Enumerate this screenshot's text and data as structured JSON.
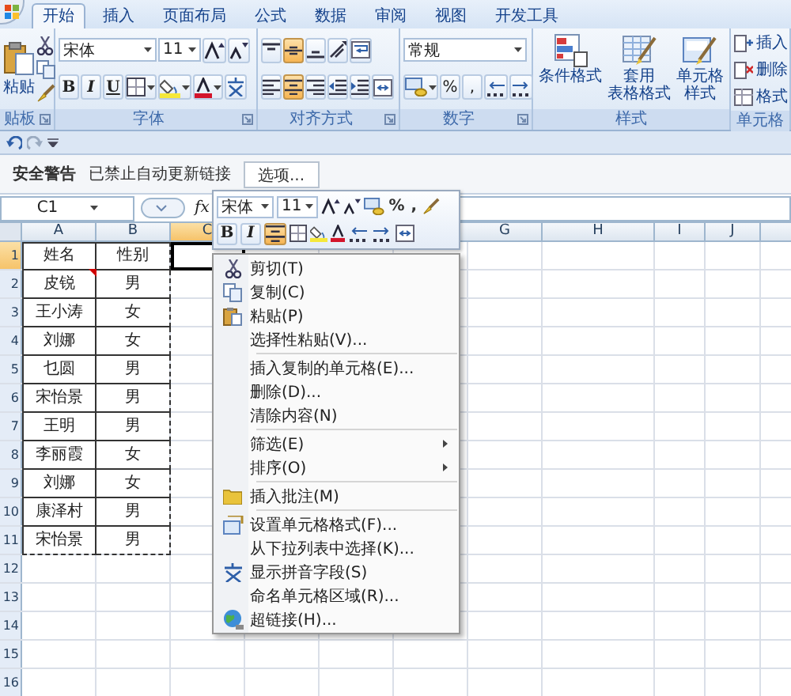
{
  "tabs": [
    {
      "label": "开始",
      "selected": true
    },
    {
      "label": "插入",
      "selected": false
    },
    {
      "label": "页面布局",
      "selected": false
    },
    {
      "label": "公式",
      "selected": false
    },
    {
      "label": "数据",
      "selected": false
    },
    {
      "label": "审阅",
      "selected": false
    },
    {
      "label": "视图",
      "selected": false
    },
    {
      "label": "开发工具",
      "selected": false
    }
  ],
  "ribbon": {
    "clipboard": {
      "title": "贴板",
      "paste": "粘贴"
    },
    "font": {
      "title": "字体",
      "font": "宋体",
      "size": "11",
      "styles": [
        "B",
        "I",
        "U"
      ]
    },
    "alignment": {
      "title": "对齐方式",
      "buttons": [
        {
          "kind": "align-top",
          "pressed": false
        },
        {
          "kind": "align-middle",
          "pressed": true
        },
        {
          "kind": "align-bottom",
          "pressed": false
        },
        {
          "kind": "orient",
          "pressed": false
        },
        {
          "kind": "wrap",
          "pressed": false
        },
        {
          "kind": "align-left",
          "pressed": false
        },
        {
          "kind": "align-center",
          "pressed": true
        },
        {
          "kind": "align-right",
          "pressed": false
        },
        {
          "kind": "indent-dec",
          "pressed": false
        },
        {
          "kind": "indent-inc",
          "pressed": false
        },
        {
          "kind": "merge",
          "pressed": false
        }
      ]
    },
    "number": {
      "title": "数字",
      "format": "常规",
      "symbols": [
        "%",
        ","
      ]
    },
    "styles": {
      "title": "样式",
      "buttons": [
        {
          "kind": "cond-format",
          "lines": [
            "条件格式"
          ]
        },
        {
          "kind": "table-format",
          "lines": [
            "套用",
            "表格格式"
          ]
        },
        {
          "kind": "cell-style",
          "lines": [
            "单元格",
            "样式"
          ]
        }
      ]
    },
    "cells": {
      "title": "单元格",
      "buttons": [
        {
          "kind": "insert-cells",
          "label": "插入"
        },
        {
          "kind": "delete-cells",
          "label": "删除"
        },
        {
          "kind": "format-cells",
          "label": "格式"
        }
      ]
    }
  },
  "security_bar": {
    "title": "安全警告",
    "message": "已禁止自动更新链接",
    "button": "选项..."
  },
  "formula_bar": {
    "name_box": "C1",
    "function_label": "fx"
  },
  "sheet": {
    "copy_marquee": true,
    "columns": [
      {
        "label": "A",
        "selected": false
      },
      {
        "label": "B",
        "selected": false
      },
      {
        "label": "C",
        "selected": true
      },
      {
        "label": "G",
        "selected": false
      },
      {
        "label": "H",
        "selected": false
      },
      {
        "label": "I",
        "selected": false
      },
      {
        "label": "J",
        "selected": false
      }
    ],
    "rows": [
      {
        "number": "1",
        "selected": true,
        "cells": [
          {
            "text": "姓名",
            "comment": false
          },
          {
            "text": "性别",
            "comment": false
          }
        ]
      },
      {
        "number": "2",
        "selected": false,
        "cells": [
          {
            "text": "皮锐",
            "comment": true
          },
          {
            "text": "男",
            "comment": false
          }
        ]
      },
      {
        "number": "3",
        "selected": false,
        "cells": [
          {
            "text": "王小涛",
            "comment": false
          },
          {
            "text": "女",
            "comment": false
          }
        ]
      },
      {
        "number": "4",
        "selected": false,
        "cells": [
          {
            "text": "刘娜",
            "comment": false
          },
          {
            "text": "女",
            "comment": false
          }
        ]
      },
      {
        "number": "5",
        "selected": false,
        "cells": [
          {
            "text": "乜圆",
            "comment": false
          },
          {
            "text": "男",
            "comment": false
          }
        ]
      },
      {
        "number": "6",
        "selected": false,
        "cells": [
          {
            "text": "宋怡景",
            "comment": false
          },
          {
            "text": "男",
            "comment": false
          }
        ]
      },
      {
        "number": "7",
        "selected": false,
        "cells": [
          {
            "text": "王明",
            "comment": false
          },
          {
            "text": "男",
            "comment": false
          }
        ]
      },
      {
        "number": "8",
        "selected": false,
        "cells": [
          {
            "text": "李丽霞",
            "comment": false
          },
          {
            "text": "女",
            "comment": false
          }
        ]
      },
      {
        "number": "9",
        "selected": false,
        "cells": [
          {
            "text": "刘娜",
            "comment": false
          },
          {
            "text": "女",
            "comment": false
          }
        ]
      },
      {
        "number": "10",
        "selected": false,
        "cells": [
          {
            "text": "康泽村",
            "comment": false
          },
          {
            "text": "男",
            "comment": false
          }
        ]
      },
      {
        "number": "11",
        "selected": false,
        "cells": [
          {
            "text": "宋怡景",
            "comment": false
          },
          {
            "text": "男",
            "comment": false
          }
        ]
      },
      {
        "number": "12",
        "selected": false
      },
      {
        "number": "13",
        "selected": false
      },
      {
        "number": "14",
        "selected": false
      },
      {
        "number": "15",
        "selected": false
      },
      {
        "number": "16",
        "selected": false
      }
    ]
  },
  "mini_toolbar": {
    "font": "宋体",
    "size": "11",
    "symbols": [
      "%",
      ","
    ],
    "styles": [
      "B",
      "I"
    ],
    "center_pressed": true
  },
  "context_menu": [
    {
      "kind": "cut",
      "label": "剪切(T)"
    },
    {
      "kind": "copy",
      "label": "复制(C)"
    },
    {
      "kind": "paste",
      "label": "粘贴(P)"
    },
    {
      "kind": "command",
      "label": "选择性粘贴(V)..."
    },
    {
      "kind": "separator"
    },
    {
      "kind": "command",
      "label": "插入复制的单元格(E)..."
    },
    {
      "kind": "command",
      "label": "删除(D)..."
    },
    {
      "kind": "command",
      "label": "清除内容(N)"
    },
    {
      "kind": "separator"
    },
    {
      "kind": "submenu",
      "label": "筛选(E)"
    },
    {
      "kind": "submenu",
      "label": "排序(O)"
    },
    {
      "kind": "separator"
    },
    {
      "kind": "comment",
      "label": "插入批注(M)"
    },
    {
      "kind": "separator"
    },
    {
      "kind": "format",
      "label": "设置单元格格式(F)..."
    },
    {
      "kind": "command",
      "label": "从下拉列表中选择(K)..."
    },
    {
      "kind": "phonetic",
      "label": "显示拼音字段(S)"
    },
    {
      "kind": "command",
      "label": "命名单元格区域(R)..."
    },
    {
      "kind": "link",
      "label": "超链接(H)..."
    }
  ]
}
